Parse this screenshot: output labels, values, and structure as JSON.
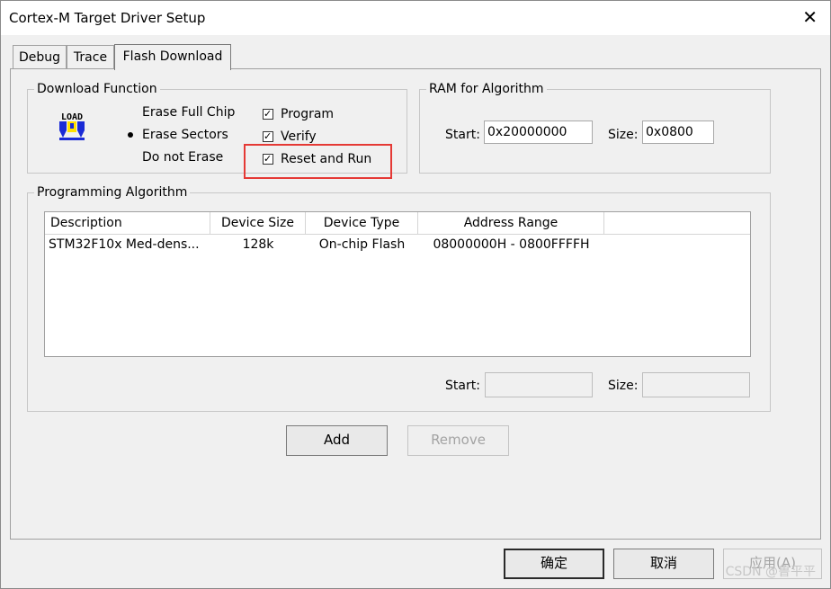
{
  "window": {
    "title": "Cortex-M Target Driver Setup"
  },
  "tabs": [
    {
      "label": "Debug",
      "active": false
    },
    {
      "label": "Trace",
      "active": false
    },
    {
      "label": "Flash Download",
      "active": true
    }
  ],
  "download_function": {
    "title": "Download Function",
    "icon_text": "LOAD",
    "erase_options": [
      {
        "label": "Erase Full Chip",
        "selected": false
      },
      {
        "label": "Erase Sectors",
        "selected": true
      },
      {
        "label": "Do not Erase",
        "selected": false
      }
    ],
    "checks": [
      {
        "label": "Program",
        "checked": true
      },
      {
        "label": "Verify",
        "checked": true
      },
      {
        "label": "Reset and Run",
        "checked": true
      }
    ]
  },
  "ram_for_algorithm": {
    "title": "RAM for Algorithm",
    "start_label": "Start:",
    "start_value": "0x20000000",
    "size_label": "Size:",
    "size_value": "0x0800"
  },
  "programming_algorithm": {
    "title": "Programming Algorithm",
    "columns": [
      "Description",
      "Device Size",
      "Device Type",
      "Address Range"
    ],
    "rows": [
      {
        "description": "STM32F10x Med-dens...",
        "device_size": "128k",
        "device_type": "On-chip Flash",
        "address_range": "08000000H - 0800FFFFH"
      }
    ],
    "start_label": "Start:",
    "start_value": "",
    "size_label": "Size:",
    "size_value": ""
  },
  "buttons": {
    "add": "Add",
    "remove": "Remove"
  },
  "footer": {
    "ok": "确定",
    "cancel": "取消",
    "apply": "应用(A)"
  },
  "watermark": "CSDN @鲁平平",
  "colors": {
    "highlight": "#e53935",
    "window_bg": "#f0f0f0"
  }
}
